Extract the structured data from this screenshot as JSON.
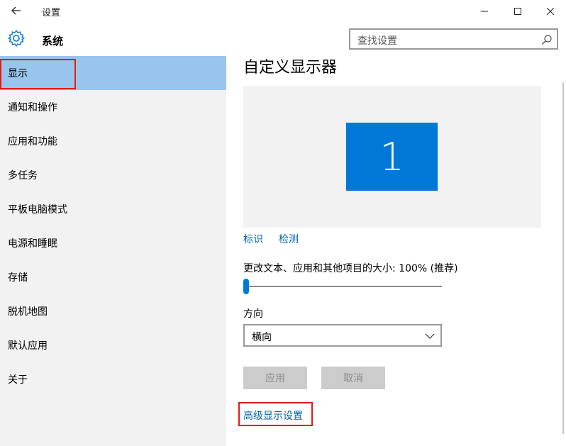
{
  "window": {
    "title": "设置",
    "minimize_icon": "minimize-icon",
    "maximize_icon": "maximize-icon",
    "close_icon": "close-icon"
  },
  "header": {
    "section_title": "系统",
    "search_placeholder": "查找设置"
  },
  "sidebar": {
    "items": [
      {
        "label": "显示",
        "selected": true
      },
      {
        "label": "通知和操作"
      },
      {
        "label": "应用和功能"
      },
      {
        "label": "多任务"
      },
      {
        "label": "平板电脑模式"
      },
      {
        "label": "电源和睡眠"
      },
      {
        "label": "存储"
      },
      {
        "label": "脱机地图"
      },
      {
        "label": "默认应用"
      },
      {
        "label": "关于"
      }
    ]
  },
  "main": {
    "title": "自定义显示器",
    "monitor_number": "1",
    "identify_link": "标识",
    "detect_link": "检测",
    "size_label": "更改文本、应用和其他项目的大小: 100% (推荐)",
    "size_value_percent": 100,
    "orientation_label": "方向",
    "orientation_value": "横向",
    "apply_button": "应用",
    "cancel_button": "取消",
    "advanced_link": "高级显示设置"
  },
  "colors": {
    "accent": "#0078d7",
    "selection": "#99c5ec",
    "link": "#0063b1",
    "highlight_box": "#e21a1a"
  }
}
